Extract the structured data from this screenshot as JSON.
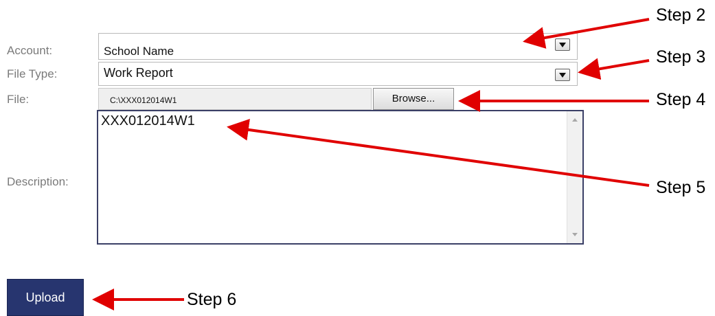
{
  "form": {
    "account_label": "Account:",
    "account_value": "School Name",
    "filetype_label": "File Type:",
    "filetype_value": "Work Report",
    "file_label": "File:",
    "file_value": "C:\\XXX012014W1",
    "browse_label": "Browse...",
    "description_label": "Description:",
    "description_value": "XXX012014W1",
    "upload_label": "Upload"
  },
  "annotations": {
    "step2": "Step 2",
    "step3": "Step 3",
    "step4": "Step 4",
    "step5": "Step 5",
    "step6": "Step 6",
    "arrow_color": "#e00000"
  }
}
